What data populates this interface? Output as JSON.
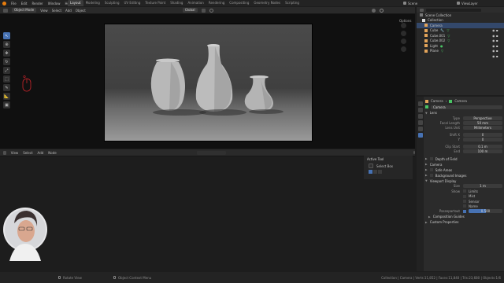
{
  "topbar": {
    "menus": [
      "File",
      "Edit",
      "Render",
      "Window",
      "Help"
    ],
    "workspaces": [
      "Layout",
      "Modeling",
      "Sculpting",
      "UV Editing",
      "Texture Paint",
      "Shading",
      "Animation",
      "Rendering",
      "Compositing",
      "Geometry Nodes",
      "Scripting"
    ],
    "scene": "Scene",
    "view_layer": "ViewLayer"
  },
  "viewport_header": {
    "mode": "Object Mode",
    "menus": [
      "View",
      "Select",
      "Add",
      "Object"
    ],
    "transform": "Global",
    "options": "Options"
  },
  "lower_header": {
    "menus": [
      "View",
      "Select",
      "Add",
      "Node"
    ]
  },
  "active_tool_panel": {
    "title": "Active Tool",
    "tool": "Select Box"
  },
  "outliner": {
    "root": "Scene Collection",
    "collection": "Collection",
    "items": [
      {
        "name": "Camera",
        "selected": true
      },
      {
        "name": "Cube",
        "selected": false
      },
      {
        "name": "Cube.001",
        "selected": false
      },
      {
        "name": "Cube.002",
        "selected": false
      },
      {
        "name": "Light",
        "selected": false
      },
      {
        "name": "Plane",
        "selected": false
      }
    ]
  },
  "properties": {
    "breadcrumb": [
      "Camera",
      "Camera"
    ],
    "datablock": "Camera",
    "lens_section": "Lens",
    "rows": [
      {
        "label": "Type",
        "value": "Perspective"
      },
      {
        "label": "Focal Length",
        "value": "50 mm"
      },
      {
        "label": "Lens Unit",
        "value": "Millimeters"
      },
      {
        "label": "Shift X",
        "value": "0"
      },
      {
        "label": "Y",
        "value": "0"
      },
      {
        "label": "Clip Start",
        "value": "0.1 m"
      },
      {
        "label": "End",
        "value": "100 m"
      }
    ],
    "sections": [
      "Depth of Field",
      "Camera",
      "Safe Areas",
      "Background Images"
    ],
    "viewport_display": {
      "title": "Viewport Display",
      "size_label": "Size",
      "size_value": "1 m",
      "show_label": "Show",
      "show_items": [
        "Limits",
        "Mist",
        "Sensor",
        "Name"
      ],
      "passepartout_label": "Passepartout",
      "passepartout_value": "0.500",
      "passepartout_fraction": 0.5
    },
    "subsections": [
      "Composition Guides",
      "Custom Properties"
    ]
  },
  "statusbar": {
    "left": "Rotate View",
    "middle": "Object Context Menu",
    "right": "Collection | Camera | Verts:11,852 | Faces:11,840 | Tris:23,680 | Objects:1/6"
  },
  "colors": {
    "accent": "#4772b3",
    "selected_row": "#33486b",
    "camera_frame": "#2a2a2a"
  }
}
